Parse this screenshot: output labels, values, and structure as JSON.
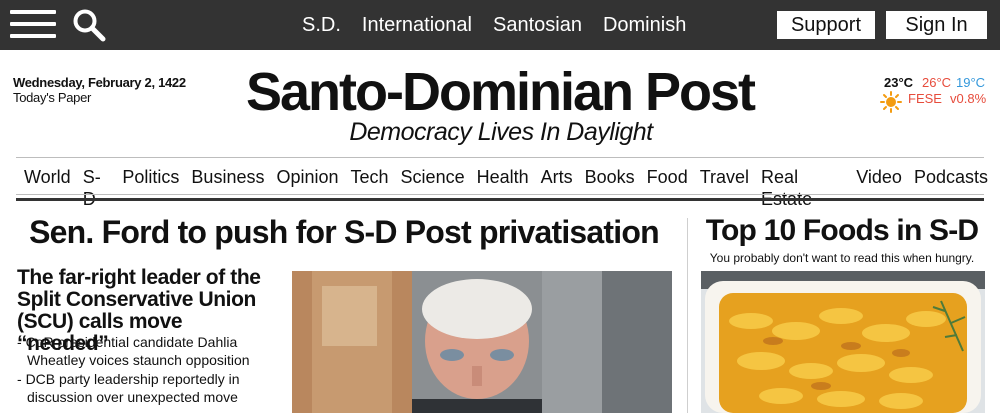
{
  "topbar": {
    "nav": [
      "S.D.",
      "International",
      "Santosian",
      "Dominish"
    ],
    "support_label": "Support",
    "signin_label": "Sign In",
    "icons": [
      "menu-icon",
      "search-icon"
    ]
  },
  "masthead": {
    "date": "Wednesday, February 2, 1422",
    "todays_paper": "Today's Paper",
    "title": "Santo-Dominian Post",
    "tagline": "Democracy Lives In Daylight"
  },
  "weather": {
    "temp": "23°C",
    "high": "26°C",
    "low": "19°C",
    "index_name": "FESE",
    "index_change": "v0.8%",
    "icon": "sun-icon",
    "colors": {
      "high": "#e74c3c",
      "low": "#3498db",
      "index": "#e74c3c",
      "sun": "#f39c12"
    }
  },
  "sections": [
    "World",
    "S-D",
    "Politics",
    "Business",
    "Opinion",
    "Tech",
    "Science",
    "Health",
    "Arts",
    "Books",
    "Food",
    "Travel",
    "Real Estate",
    "Video",
    "Podcasts"
  ],
  "main_story": {
    "headline": "Sen. Ford to push for S-D Post privatisation",
    "subhead": "The far-right leader of the Split Conservative Union (SCU) calls move “needed”",
    "bullets": [
      "CoR presidential candidate Dahlia Wheatley voices staunch opposition",
      "DCB party leadership reportedly in discussion over unexpected move"
    ]
  },
  "sidebar": {
    "title": "Top 10 Foods in S-D",
    "subtitle": "You probably don't want to read this when hungry."
  },
  "colors": {
    "topbar": "#333333",
    "text": "#111111"
  }
}
